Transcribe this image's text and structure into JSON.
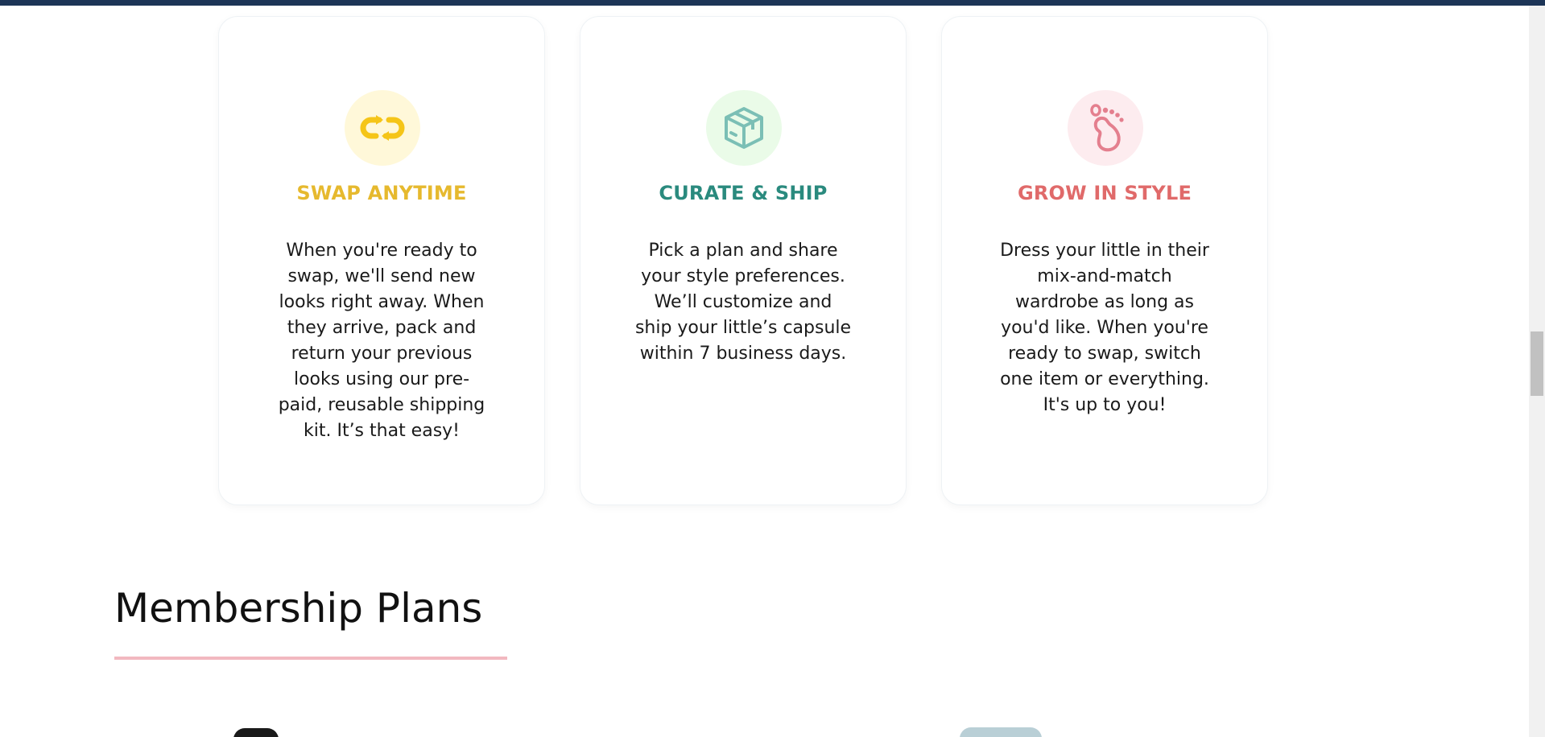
{
  "features": [
    {
      "title": "SWAP ANYTIME",
      "text": "When you're ready to swap, we'll send new looks right away. When they arrive, pack and return your previous looks using our pre-paid, reusable shipping kit. It’s that easy!",
      "icon": "swap-icon",
      "accent": "#e6b92e",
      "icon_bg": "#fff8d9"
    },
    {
      "title": "CURATE & SHIP",
      "text": "Pick a plan and share your style preferences. We’ll customize and ship your little’s capsule within 7 business days.",
      "icon": "box-icon",
      "accent": "#2a8a7e",
      "icon_bg": "#eafbe8"
    },
    {
      "title": "GROW IN STYLE",
      "text": "Dress your little in their mix-and-match wardrobe as long as you'd like. When you're ready to swap, switch one item or everything. It's up to you!",
      "icon": "footprint-icon",
      "accent": "#e06a6a",
      "icon_bg": "#fdecef"
    }
  ],
  "membership": {
    "title": "Membership Plans",
    "underline_color": "#f2b8c0"
  },
  "colors": {
    "top_bar": "#1d3557"
  }
}
